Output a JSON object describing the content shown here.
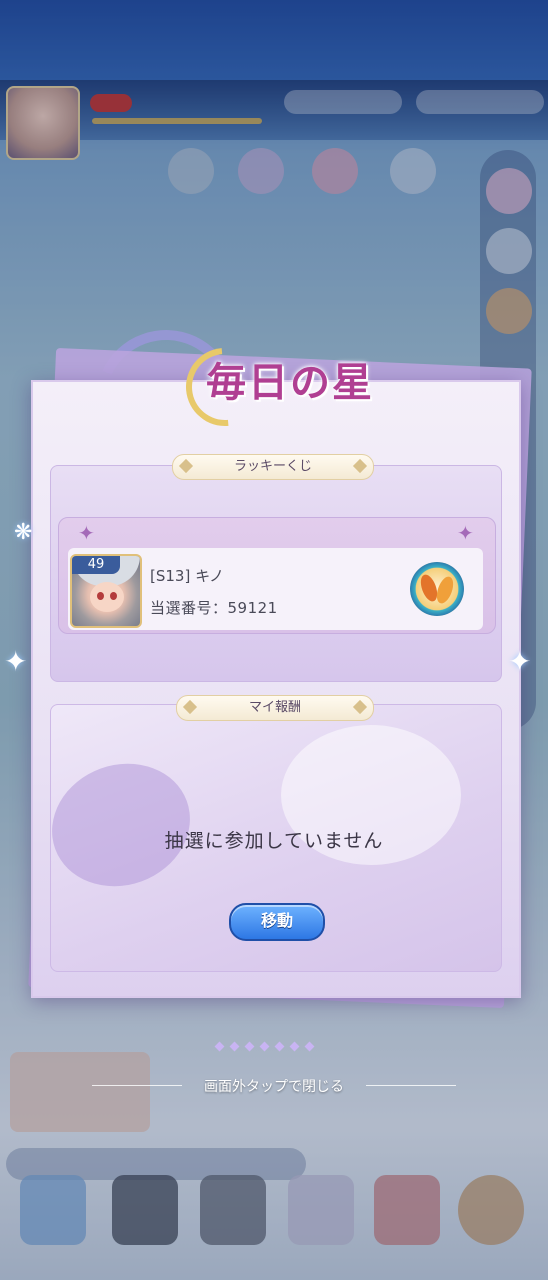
{
  "modal": {
    "title": "毎日の星",
    "lottery_section": {
      "heading": "ラッキーくじ",
      "winner": {
        "level": "49",
        "season_name": "[S13] キノ",
        "winning_number_label": "当選番号：59121"
      }
    },
    "reward_section": {
      "heading": "マイ報酬",
      "status_text": "抽選に参加していません",
      "move_button_label": "移動"
    },
    "page_dots": 7,
    "close_hint": "画面外タップで閉じる"
  },
  "colors": {
    "title": "#b03f92",
    "button": "#2d77e4",
    "panel": "#e9e1f4"
  }
}
